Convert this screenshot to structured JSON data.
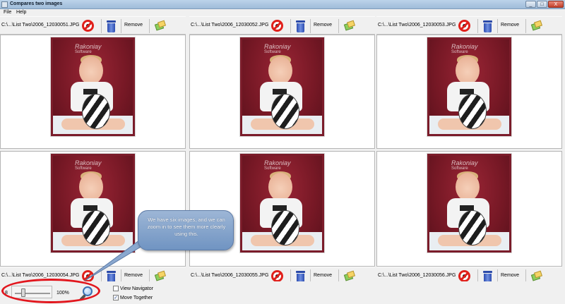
{
  "window": {
    "title": "Compares two images",
    "buttons": [
      "_",
      "□",
      "X"
    ]
  },
  "menu": {
    "items": [
      "File",
      "Help"
    ]
  },
  "panels": [
    {
      "path": "C:\\...\\List Two\\2006_12030051.JPG",
      "remove_label": "Remove"
    },
    {
      "path": "C:\\...\\List Two\\2006_12030052.JPG",
      "remove_label": "Remove"
    },
    {
      "path": "C:\\...\\List Two\\2006_12030053.JPG",
      "remove_label": "Remove"
    },
    {
      "path": "C:\\...\\List Two\\2006_12030054.JPG",
      "remove_label": "Remove"
    },
    {
      "path": "C:\\...\\List Two\\2006_12030055.JPG",
      "remove_label": "Remove"
    },
    {
      "path": "C:\\...\\List Two\\2006_12030056.JPG",
      "remove_label": "Remove"
    }
  ],
  "watermark": {
    "line1": "Rakoniay",
    "line2": "Software"
  },
  "zoom": {
    "min_label": "8",
    "max_label": "100%",
    "value_percent": 20
  },
  "options": {
    "view_navigator": "View Navigator",
    "view_navigator_checked": false,
    "move_together": "Move Together",
    "move_together_checked": true
  },
  "callout": {
    "text": "We have six images, and we can zoom in to see them more clearly using this."
  },
  "colors": {
    "highlight": "#e2161d",
    "callout": "#7f9fcb",
    "backdrop": "#7b1c2a"
  },
  "icons": [
    "no-entry-icon",
    "trash-bin-icon",
    "load-image-icon",
    "magnifier-icon",
    "window-icon"
  ]
}
